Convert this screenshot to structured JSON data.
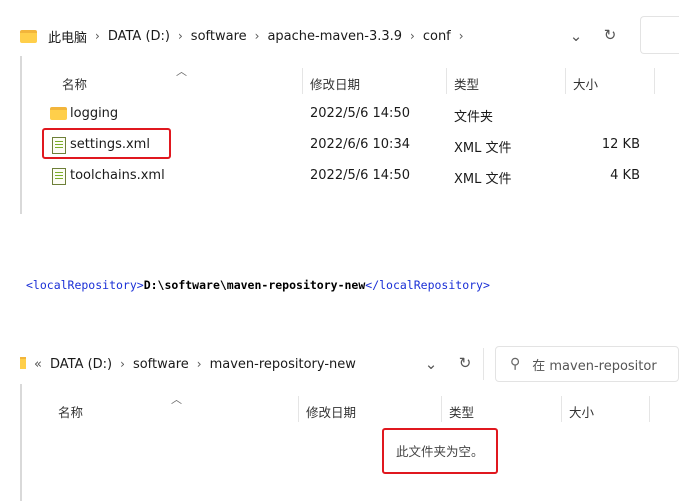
{
  "top": {
    "breadcrumb": [
      "此电脑",
      "DATA (D:)",
      "software",
      "apache-maven-3.3.9",
      "conf"
    ],
    "columns": {
      "name": "名称",
      "modified": "修改日期",
      "type": "类型",
      "size": "大小"
    },
    "files": [
      {
        "name": "logging",
        "modified": "2022/5/6 14:50",
        "type": "文件夹",
        "size": "",
        "icon": "folder-icon"
      },
      {
        "name": "settings.xml",
        "modified": "2022/6/6 10:34",
        "type": "XML 文件",
        "size": "12 KB",
        "icon": "xml-file-icon"
      },
      {
        "name": "toolchains.xml",
        "modified": "2022/5/6 14:50",
        "type": "XML 文件",
        "size": "4 KB",
        "icon": "xml-file-icon"
      }
    ]
  },
  "code": {
    "open_tag": "<localRepository>",
    "value": "D:\\software\\maven-repository-new",
    "close_tag": "</localRepository>"
  },
  "bottom": {
    "overflow": "«",
    "breadcrumb": [
      "DATA (D:)",
      "software",
      "maven-repository-new"
    ],
    "search_placeholder": "在 maven-repositor",
    "columns": {
      "name": "名称",
      "modified": "修改日期",
      "type": "类型",
      "size": "大小"
    },
    "empty_message": "此文件夹为空。"
  },
  "colors": {
    "highlight_red": "#e0181f",
    "xml_tag_blue": "#1a2fd6",
    "folder_yellow": "#ffcf4a"
  }
}
